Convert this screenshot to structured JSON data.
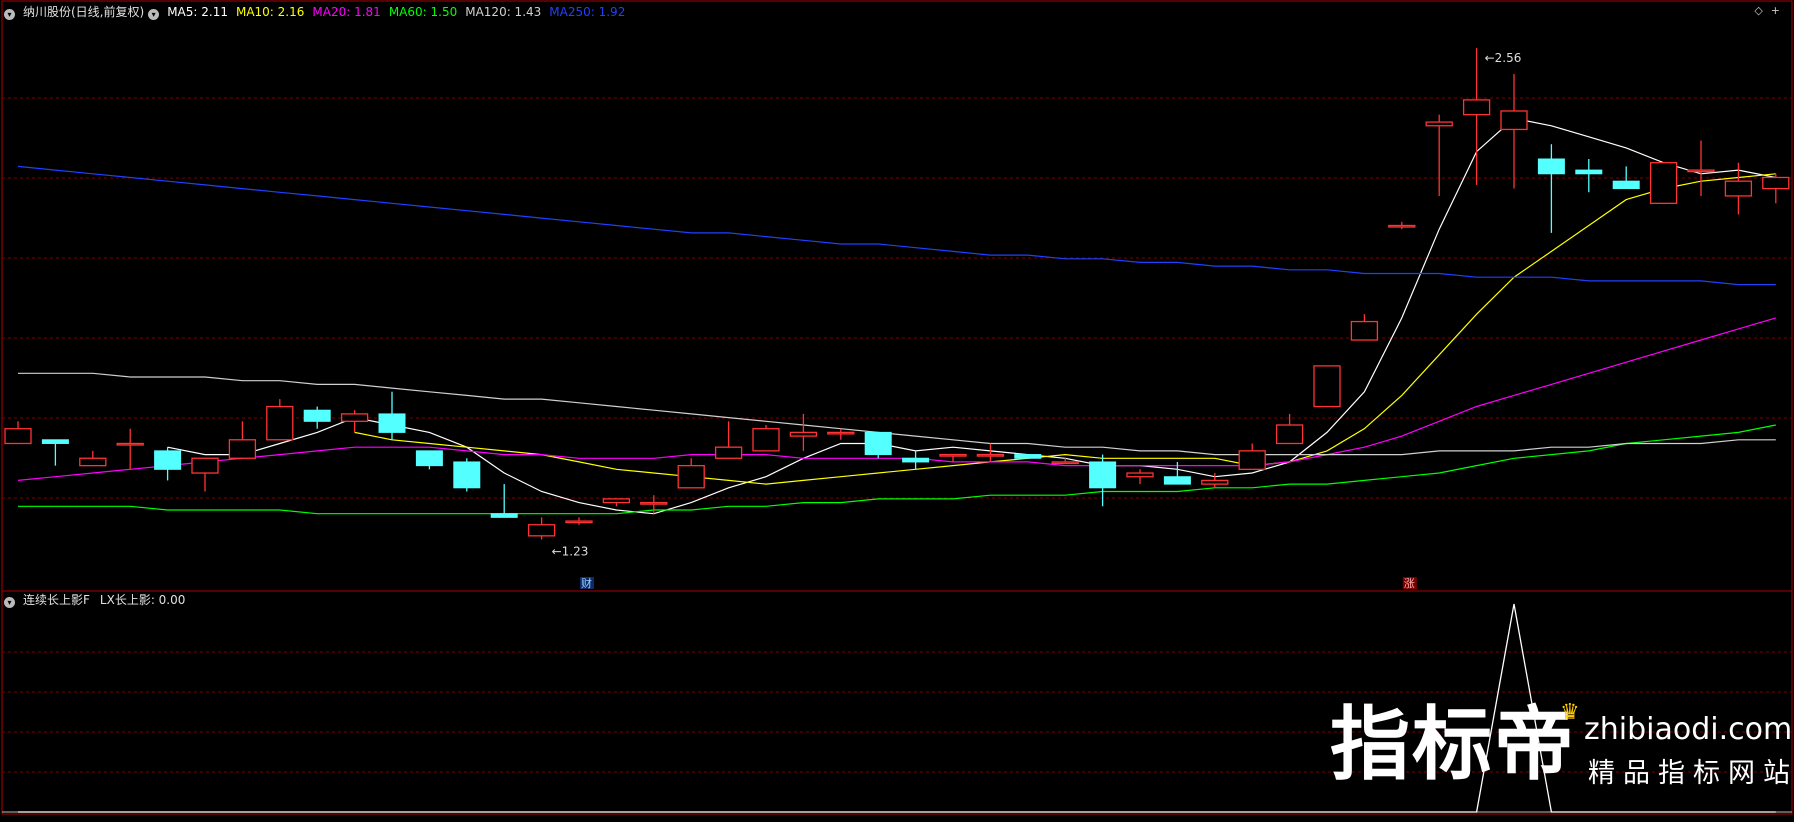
{
  "main_header": {
    "title": "纳川股份(日线,前复权)",
    "ma": [
      {
        "label": "MA5: ",
        "value": "2.11",
        "color": "#ffffff"
      },
      {
        "label": "MA10: ",
        "value": "2.16",
        "color": "#ffff00"
      },
      {
        "label": "MA20: ",
        "value": "1.81",
        "color": "#ff00ff"
      },
      {
        "label": "MA60: ",
        "value": "1.50",
        "color": "#00ff00"
      },
      {
        "label": "MA120: ",
        "value": "1.43",
        "color": "#d0d0d0"
      },
      {
        "label": "MA250: ",
        "value": "1.92",
        "color": "#2040ff"
      }
    ]
  },
  "sub_header": {
    "title": "连续长上影F",
    "indicator_label": "LX长上影: ",
    "indicator_value": "0.00"
  },
  "markers": {
    "high_label": "2.56",
    "low_label": "1.23",
    "badge_cai": "财",
    "badge_zhang": "涨"
  },
  "watermark": {
    "main": "指标帝",
    "domain": "zhibiaodi.com",
    "slogan": "精品指标网站"
  },
  "colors": {
    "up": "#ff3333",
    "down": "#54ffff",
    "grid": "#7a0000",
    "frame": "#b00000"
  },
  "chart_data": {
    "type": "candlestick",
    "y_range": [
      1.18,
      2.62
    ],
    "ohlc": [
      [
        1.49,
        1.49,
        1.55,
        1.53
      ],
      [
        1.5,
        1.5,
        1.43,
        1.49
      ],
      [
        1.43,
        1.47,
        1.43,
        1.45
      ],
      [
        1.49,
        1.53,
        1.42,
        1.49
      ],
      [
        1.47,
        1.48,
        1.39,
        1.42
      ],
      [
        1.41,
        1.45,
        1.36,
        1.45
      ],
      [
        1.45,
        1.55,
        1.45,
        1.5
      ],
      [
        1.5,
        1.61,
        1.5,
        1.59
      ],
      [
        1.58,
        1.59,
        1.53,
        1.55
      ],
      [
        1.55,
        1.58,
        1.52,
        1.57
      ],
      [
        1.57,
        1.63,
        1.5,
        1.52
      ],
      [
        1.47,
        1.47,
        1.42,
        1.43
      ],
      [
        1.44,
        1.45,
        1.36,
        1.37
      ],
      [
        1.3,
        1.38,
        1.29,
        1.29
      ],
      [
        1.24,
        1.29,
        1.23,
        1.27
      ],
      [
        1.28,
        1.29,
        1.27,
        1.28
      ],
      [
        1.33,
        1.34,
        1.32,
        1.34
      ],
      [
        1.33,
        1.35,
        1.3,
        1.33
      ],
      [
        1.37,
        1.45,
        1.37,
        1.43
      ],
      [
        1.45,
        1.55,
        1.45,
        1.48
      ],
      [
        1.47,
        1.54,
        1.47,
        1.53
      ],
      [
        1.51,
        1.57,
        1.47,
        1.52
      ],
      [
        1.52,
        1.53,
        1.5,
        1.52
      ],
      [
        1.52,
        1.52,
        1.45,
        1.46
      ],
      [
        1.45,
        1.47,
        1.42,
        1.44
      ],
      [
        1.46,
        1.46,
        1.44,
        1.46
      ],
      [
        1.46,
        1.49,
        1.44,
        1.46
      ],
      [
        1.46,
        1.46,
        1.45,
        1.45
      ],
      [
        1.44,
        1.45,
        1.44,
        1.44
      ],
      [
        1.44,
        1.46,
        1.32,
        1.37
      ],
      [
        1.4,
        1.42,
        1.38,
        1.41
      ],
      [
        1.4,
        1.44,
        1.38,
        1.38
      ],
      [
        1.38,
        1.41,
        1.37,
        1.39
      ],
      [
        1.42,
        1.49,
        1.42,
        1.47
      ],
      [
        1.49,
        1.57,
        1.49,
        1.54
      ],
      [
        1.59,
        1.67,
        1.59,
        1.7
      ],
      [
        1.77,
        1.84,
        1.77,
        1.82
      ],
      [
        2.08,
        2.09,
        2.07,
        2.08
      ],
      [
        2.35,
        2.38,
        2.16,
        2.36
      ],
      [
        2.38,
        2.56,
        2.19,
        2.42
      ],
      [
        2.34,
        2.49,
        2.18,
        2.39
      ],
      [
        2.26,
        2.3,
        2.06,
        2.22
      ],
      [
        2.23,
        2.26,
        2.17,
        2.22
      ],
      [
        2.2,
        2.24,
        2.2,
        2.18
      ],
      [
        2.14,
        2.25,
        2.14,
        2.25
      ],
      [
        2.23,
        2.31,
        2.16,
        2.23
      ],
      [
        2.16,
        2.25,
        2.11,
        2.2
      ],
      [
        2.18,
        2.22,
        2.14,
        2.21
      ]
    ],
    "ma_series": [
      {
        "name": "MA5",
        "color": "#ffffff",
        "values": [
          null,
          null,
          null,
          null,
          1.48,
          1.46,
          1.46,
          1.49,
          1.52,
          1.56,
          1.54,
          1.52,
          1.48,
          1.41,
          1.36,
          1.33,
          1.31,
          1.3,
          1.33,
          1.37,
          1.4,
          1.45,
          1.49,
          1.49,
          1.47,
          1.48,
          1.47,
          1.46,
          1.45,
          1.43,
          1.43,
          1.42,
          1.4,
          1.41,
          1.44,
          1.52,
          1.63,
          1.83,
          2.07,
          2.28,
          2.37,
          2.35,
          2.32,
          2.29,
          2.25,
          2.22,
          2.23,
          2.21
        ]
      },
      {
        "name": "MA10",
        "color": "#ffff00",
        "values": [
          null,
          null,
          null,
          null,
          null,
          null,
          null,
          null,
          null,
          1.52,
          1.5,
          1.49,
          1.48,
          1.47,
          1.46,
          1.44,
          1.42,
          1.41,
          1.4,
          1.39,
          1.38,
          1.39,
          1.4,
          1.41,
          1.42,
          1.43,
          1.44,
          1.45,
          1.46,
          1.45,
          1.45,
          1.45,
          1.45,
          1.43,
          1.44,
          1.47,
          1.53,
          1.62,
          1.73,
          1.84,
          1.94,
          2.01,
          2.08,
          2.15,
          2.18,
          2.2,
          2.21,
          2.22
        ]
      },
      {
        "name": "MA20",
        "color": "#ff00ff",
        "values": [
          1.39,
          1.4,
          1.41,
          1.42,
          1.43,
          1.44,
          1.45,
          1.46,
          1.47,
          1.48,
          1.48,
          1.48,
          1.47,
          1.46,
          1.46,
          1.45,
          1.45,
          1.45,
          1.46,
          1.46,
          1.46,
          1.45,
          1.45,
          1.45,
          1.45,
          1.44,
          1.44,
          1.44,
          1.43,
          1.43,
          1.43,
          1.43,
          1.43,
          1.43,
          1.44,
          1.46,
          1.48,
          1.51,
          1.55,
          1.59,
          1.62,
          1.65,
          1.68,
          1.71,
          1.74,
          1.77,
          1.8,
          1.83
        ]
      },
      {
        "name": "MA60",
        "color": "#00ff00",
        "values": [
          1.32,
          1.32,
          1.32,
          1.32,
          1.31,
          1.31,
          1.31,
          1.31,
          1.3,
          1.3,
          1.3,
          1.3,
          1.3,
          1.3,
          1.3,
          1.3,
          1.3,
          1.31,
          1.31,
          1.32,
          1.32,
          1.33,
          1.33,
          1.34,
          1.34,
          1.34,
          1.35,
          1.35,
          1.35,
          1.36,
          1.36,
          1.36,
          1.37,
          1.37,
          1.38,
          1.38,
          1.39,
          1.4,
          1.41,
          1.43,
          1.45,
          1.46,
          1.47,
          1.49,
          1.5,
          1.51,
          1.52,
          1.54
        ]
      },
      {
        "name": "MA120",
        "color": "#d0d0d0",
        "values": [
          1.68,
          1.68,
          1.68,
          1.67,
          1.67,
          1.67,
          1.66,
          1.66,
          1.65,
          1.65,
          1.64,
          1.63,
          1.62,
          1.61,
          1.61,
          1.6,
          1.59,
          1.58,
          1.57,
          1.56,
          1.55,
          1.54,
          1.53,
          1.52,
          1.51,
          1.5,
          1.49,
          1.49,
          1.48,
          1.48,
          1.47,
          1.47,
          1.46,
          1.46,
          1.46,
          1.46,
          1.46,
          1.46,
          1.47,
          1.47,
          1.47,
          1.48,
          1.48,
          1.49,
          1.49,
          1.49,
          1.5,
          1.5
        ]
      },
      {
        "name": "MA250",
        "color": "#2040ff",
        "values": [
          2.24,
          2.23,
          2.22,
          2.21,
          2.2,
          2.19,
          2.18,
          2.17,
          2.16,
          2.15,
          2.14,
          2.13,
          2.12,
          2.11,
          2.1,
          2.09,
          2.08,
          2.07,
          2.06,
          2.06,
          2.05,
          2.04,
          2.03,
          2.03,
          2.02,
          2.01,
          2.0,
          2.0,
          1.99,
          1.99,
          1.98,
          1.98,
          1.97,
          1.97,
          1.96,
          1.96,
          1.95,
          1.95,
          1.95,
          1.94,
          1.94,
          1.94,
          1.93,
          1.93,
          1.93,
          1.93,
          1.92,
          1.92
        ]
      }
    ],
    "indicator": {
      "name": "LX长上影",
      "y_range": [
        0,
        1
      ],
      "values": [
        0,
        0,
        0,
        0,
        0,
        0,
        0,
        0,
        0,
        0,
        0,
        0,
        0,
        0,
        0,
        0,
        0,
        0,
        0,
        0,
        0,
        0,
        0,
        0,
        0,
        0,
        0,
        0,
        0,
        0,
        0,
        0,
        0,
        0,
        0,
        0,
        0,
        0,
        0,
        0,
        1,
        0,
        0,
        0,
        0,
        0,
        0,
        0
      ]
    }
  }
}
